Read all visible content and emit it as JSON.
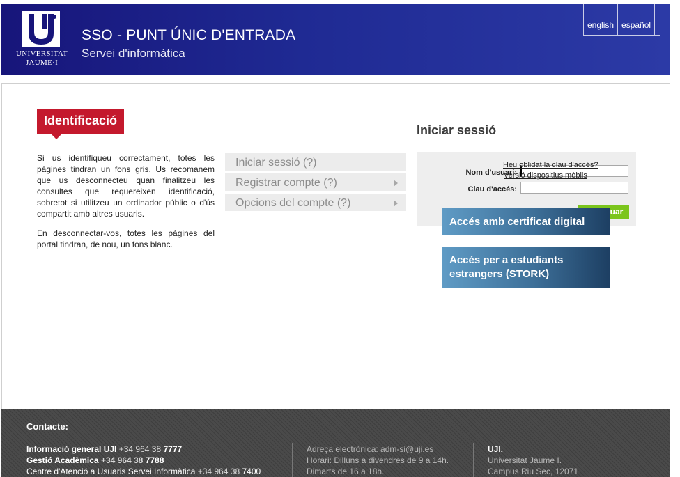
{
  "header": {
    "logo": {
      "line1": "UNIVERSITAT",
      "line2": "JAUME·I"
    },
    "title": "SSO - PUNT ÚNIC D'ENTRADA",
    "subtitle": "Servei d'informàtica",
    "languages": [
      "english",
      "español"
    ]
  },
  "colors": {
    "header": "#1f2a93",
    "badge": "#c4192d",
    "continue": "#7bc51c",
    "big_button": "#3d6f98",
    "footer": "#4a4a4a"
  },
  "left": {
    "badge": "Identificació",
    "para1": "Si us identifiqueu correctament, totes les pàgines tindran un fons gris. Us recomanem que us desconnecteu quan finalitzeu les consultes que requereixen identificació, sobretot si utilitzeu un ordinador públic o d'ús compartit amb altres usuaris.",
    "para2": "En desconnectar-vos, totes les pàgines del portal tindran, de nou, un fons blanc."
  },
  "menu": {
    "items": [
      "Iniciar sessió (?)",
      "Registrar compte (?)",
      "Opcions del compte (?)"
    ]
  },
  "login": {
    "heading": "Iniciar sessió",
    "user_label": "Nom d'usuari:",
    "user_value": "",
    "pass_label": "Clau d'accés:",
    "pass_value": "",
    "continue_label": "Continuar",
    "forgot_link": "Heu oblidat la clau d'accés?",
    "mobile_link": "Versió dispositius mòbils",
    "cert_button": "Accés amb certificat digital",
    "stork_button_line1": "Accés per a estudiants",
    "stork_button_line2": "estrangers (STORK)"
  },
  "footer": {
    "heading": "Contacte:",
    "col1": {
      "line1_label": "Informació general UJI",
      "line1_num": "+34 964 38",
      "line1_ext": "7777",
      "line2_label": "Gestió Acadèmica",
      "line2_num": "+34 964 38",
      "line2_ext": "7788",
      "line3_label": "Centre d'Atenció a Usuaris Servei Informàtica",
      "line3_num": "+34 964 38",
      "line3_ext": "7400"
    },
    "col2": {
      "line1": "Adreça electrònica: adm-si@uji.es",
      "line2": "Horari: Dilluns a divendres de 9 a 14h.",
      "line3": "Dimarts de 16 a 18h."
    },
    "col3": {
      "line1": "UJI.",
      "line2": "Universitat Jaume I.",
      "line3": "Campus Riu Sec, 12071"
    }
  }
}
